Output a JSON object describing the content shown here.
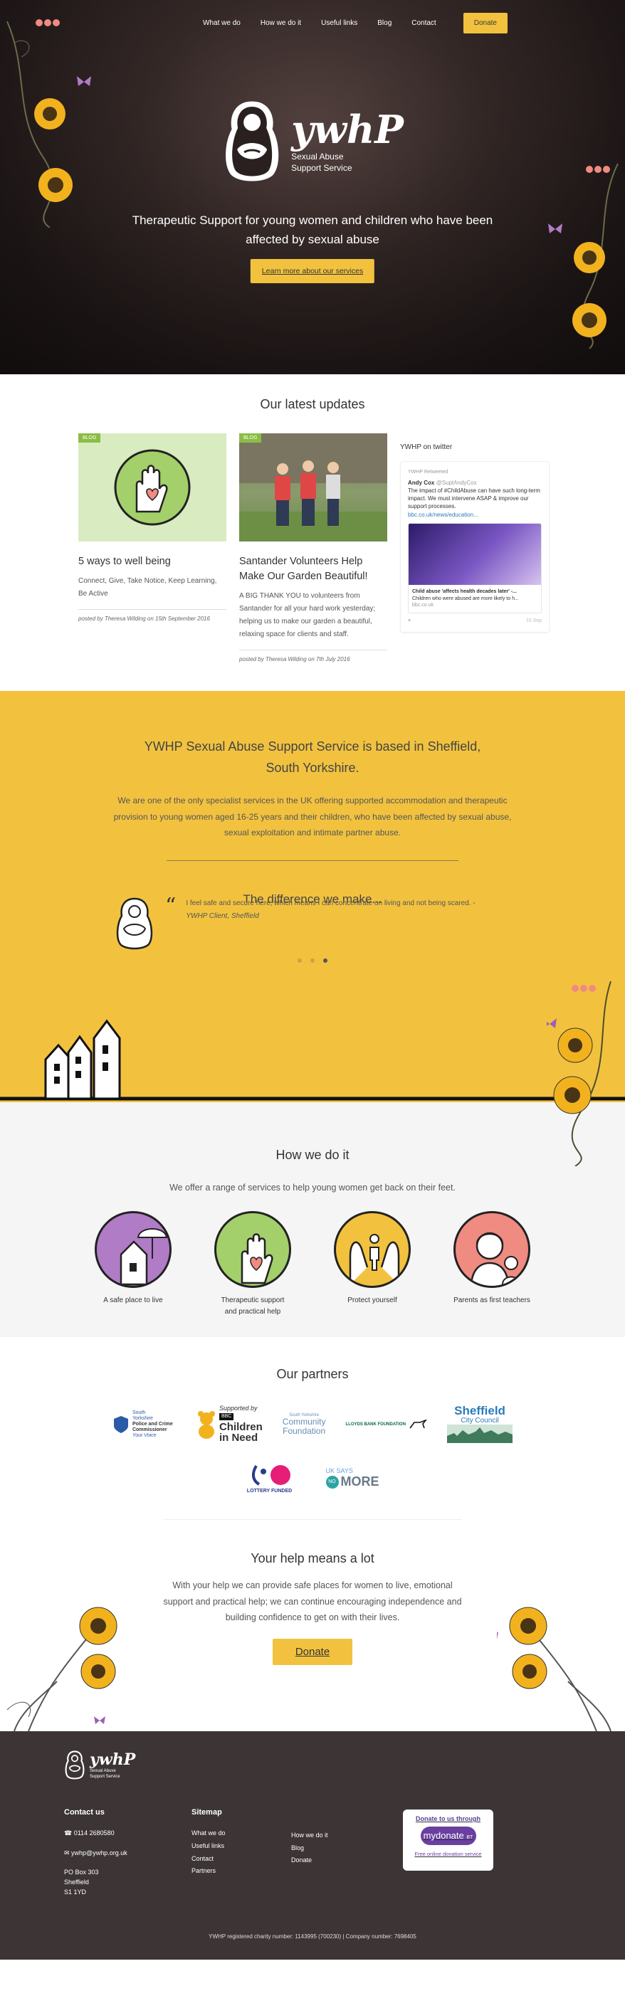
{
  "nav": {
    "items": [
      "What we do",
      "How we do it",
      "Useful links",
      "Blog",
      "Contact"
    ],
    "donate_label": "Donate"
  },
  "brand": {
    "name": "ywhP",
    "tagline_line1": "Sexual Abuse",
    "tagline_line2": "Support Service"
  },
  "hero": {
    "headline": "Therapeutic Support for young women and children who have been affected by sexual abuse",
    "cta_label": "Learn more about our services"
  },
  "updates": {
    "title": "Our latest updates",
    "posts": [
      {
        "tag": "BLOG",
        "title": "5 ways to well being",
        "excerpt": "Connect, Give, Take Notice, Keep Learning, Be Active",
        "meta": "posted by Theresa Wilding on 15th September 2016"
      },
      {
        "tag": "BLOG",
        "title": "Santander Volunteers Help Make Our Garden Beautiful!",
        "excerpt": "A BIG THANK YOU to volunteers from Santander for all your hard work yesterday; helping us to make our garden a beautiful, relaxing space for clients and staff.",
        "meta": "posted by Theresa Wilding on 7th July 2016"
      }
    ],
    "twitter": {
      "title": "YWHP on twitter",
      "retweeted": "YWHP Retweeted",
      "author": "Andy Cox",
      "handle": "@SuptAndyCox",
      "text": "The impact of #ChildAbuse can have such long-term impact. We must intervene ASAP & improve our support processes.",
      "link": "bbc.co.uk/news/education...",
      "card_title": "Child abuse 'affects health decades later' -...",
      "card_text": "Children who were abused are more likely to h...",
      "card_domain": "bbc.co.uk",
      "time": "15 Sep"
    }
  },
  "about": {
    "heading": "YWHP Sexual Abuse Support Service is based in Sheffield, South Yorkshire.",
    "intro": "We are one of the only specialist services in the UK offering supported accommodation and therapeutic provision to young women aged 16-25 years and their children, who have been affected by sexual abuse, sexual exploitation and intimate partner abuse.",
    "difference_title": "The difference we make...",
    "quote": "I feel safe and secure here, which means I can concentrate on living and not being scared. -",
    "quote_source": "YWHP Client, Sheffield",
    "quote_mark": "“"
  },
  "how": {
    "title": "How we do it",
    "lead": "We offer a range of services to help young women get back on their feet.",
    "services": [
      {
        "label": "A safe place to live",
        "color": "#b07cc6"
      },
      {
        "label": "Therapeutic support and practical help",
        "color": "#a3d06a"
      },
      {
        "label": "Protect yourself",
        "color": "#f2c23f"
      },
      {
        "label": "Parents as first teachers",
        "color": "#f08b82"
      }
    ]
  },
  "partners": {
    "title": "Our partners",
    "pcc_line1": "South",
    "pcc_line2": "Yorkshire",
    "pcc_line3": "Police and Crime",
    "pcc_line4": "Commissioner",
    "pcc_tagline": "Your Voice",
    "cin_supported": "Supported by",
    "cin_bbc": "BBC",
    "cin_line1": "Children",
    "cin_line2": "in Need",
    "cf_line1": "South Yorkshire",
    "cf_line2": "Community",
    "cf_line3": "Foundation",
    "lloyds": "LLOYDS BANK FOUNDATION",
    "sheff_line1": "Sheffield",
    "sheff_line2": "City Council",
    "lottery": "LOTTERY FUNDED",
    "nomore_line1": "UK SAYS",
    "nomore_no": "NO",
    "nomore_more": "MORE"
  },
  "help": {
    "title": "Your help means a lot",
    "text": "With your help we can provide safe places for women to live, emotional support and practical help; we can continue encouraging independence and building confidence to get on with their lives.",
    "donate_label": "Donate"
  },
  "footer": {
    "contact_title": "Contact us",
    "phone": "0114 2680580",
    "email": "ywhp@ywhp.org.uk",
    "address": [
      "PO Box 303",
      "Sheffield",
      "S1 1YD"
    ],
    "sitemap_title": "Sitemap",
    "sitemap_col1": [
      "What we do",
      "Useful links",
      "Contact",
      "Partners"
    ],
    "sitemap_col2": [
      "How we do it",
      "Blog",
      "Donate"
    ],
    "mydonate_title": "Donate to us through",
    "mydonate_brand": "mydonate",
    "mydonate_sub": "BT",
    "mydonate_footer": "Free online donation service",
    "charity": "YWHP registered charity number: 1143995 (700230) | Company number: 7698405"
  }
}
